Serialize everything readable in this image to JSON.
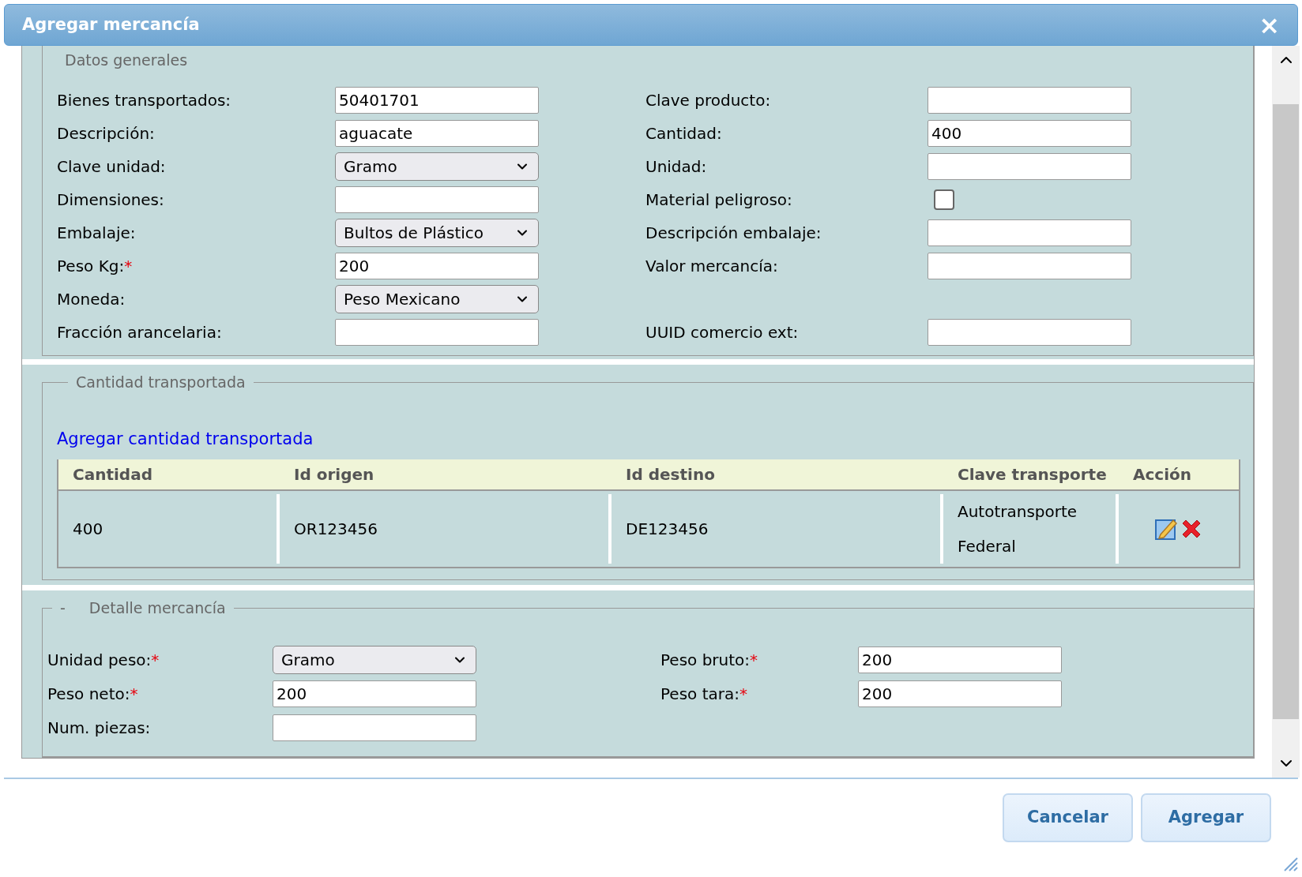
{
  "window": {
    "title": "Agregar mercancía",
    "close": "×"
  },
  "general": {
    "legend": "Datos generales",
    "rows": [
      [
        {
          "label": "Bienes transportados:",
          "kind": "text",
          "value": "50401701"
        },
        {
          "label": "Clave producto:",
          "kind": "text"
        }
      ],
      [
        {
          "label": "Descripción:",
          "kind": "text",
          "value": "aguacate"
        },
        {
          "label": "Cantidad:",
          "kind": "text",
          "value": "400"
        }
      ],
      [
        {
          "label": "Clave unidad:",
          "kind": "select",
          "value": "Gramo"
        },
        {
          "label": "Unidad:",
          "kind": "text"
        }
      ],
      [
        {
          "label": "Dimensiones:",
          "kind": "text"
        },
        {
          "label": "Material peligroso:",
          "kind": "checkbox",
          "checked": false
        }
      ],
      [
        {
          "label": "Embalaje:",
          "kind": "select",
          "value": "Bultos de Plástico"
        },
        {
          "label": "Descripción embalaje:",
          "kind": "text"
        }
      ],
      [
        {
          "label": "Peso Kg:",
          "required_mark": "*",
          "kind": "text",
          "value": "200"
        },
        {
          "label": "Valor mercancía:",
          "kind": "text"
        }
      ],
      [
        {
          "label": "Moneda:",
          "kind": "select",
          "value": "Peso Mexicano"
        }
      ],
      [
        {
          "label": "Fracción arancelaria:",
          "kind": "text"
        },
        {
          "label": "UUID comercio ext:",
          "kind": "text"
        }
      ]
    ]
  },
  "transport": {
    "legend": "Cantidad transportada",
    "add_link": "Agregar cantidad transportada",
    "table": {
      "columns": [
        "Cantidad",
        "Id origen",
        "Id destino",
        "Clave transporte",
        "Acción"
      ],
      "rows": [
        {
          "cells": [
            "400",
            "OR123456",
            "DE123456",
            "Autotransporte Federal"
          ]
        }
      ]
    }
  },
  "detail": {
    "toggle": "-",
    "legend": "Detalle mercancía",
    "rows": [
      [
        {
          "label": "Unidad peso:",
          "required_mark": "*",
          "kind": "select",
          "value": "Gramo"
        },
        {
          "label": "Peso bruto:",
          "required_mark": "*",
          "kind": "text",
          "value": "200"
        }
      ],
      [
        {
          "label": "Peso neto:",
          "required_mark": "*",
          "kind": "text",
          "value": "200"
        },
        {
          "label": "Peso tara:",
          "required_mark": "*",
          "kind": "text",
          "value": "200"
        }
      ],
      [
        {
          "label": "Num. piezas:",
          "kind": "text"
        }
      ]
    ]
  },
  "buttons": [
    "Cancelar",
    "Agregar"
  ]
}
